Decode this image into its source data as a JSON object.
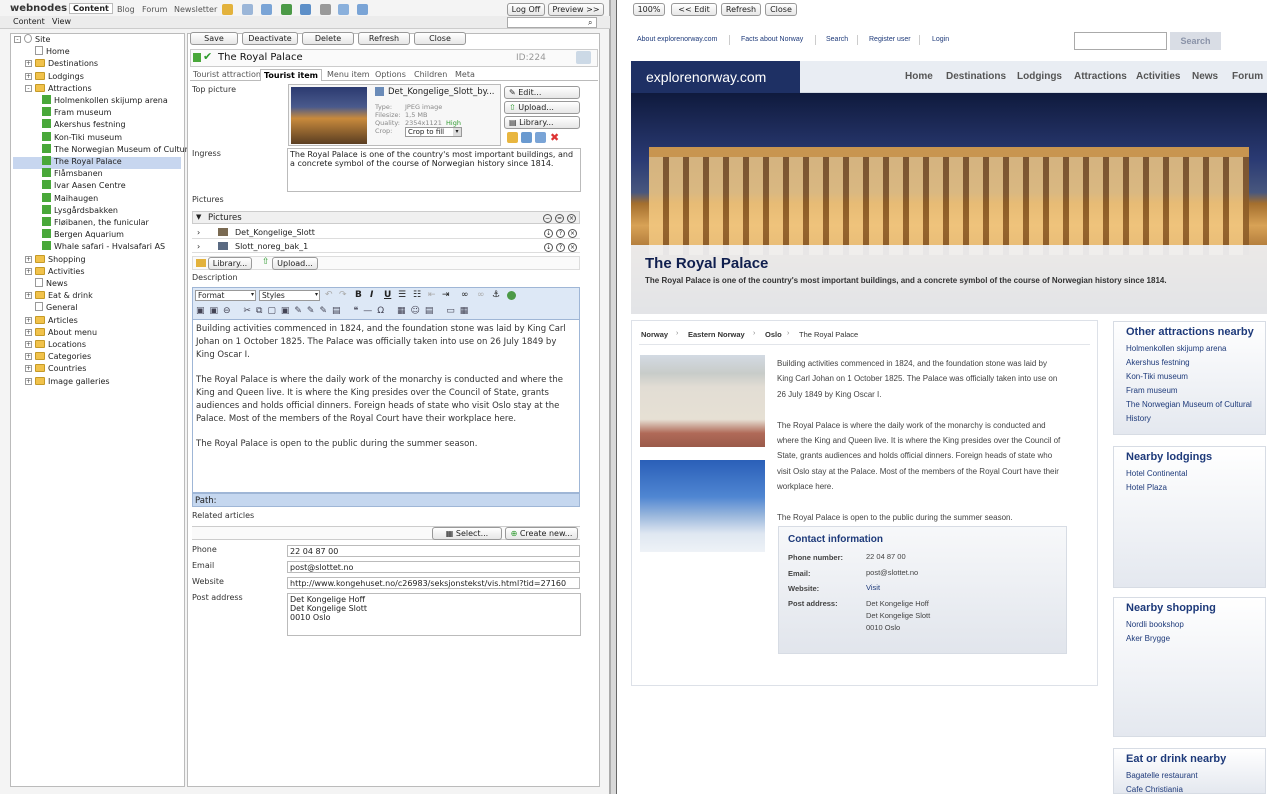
{
  "app": {
    "logo": "webnodes",
    "top_tabs": [
      "Content",
      "Blog",
      "Forum",
      "Newsletter"
    ],
    "log_off": "Log Off",
    "preview": "Preview >>",
    "menu": [
      "Content",
      "View"
    ]
  },
  "tree": [
    {
      "label": "Site",
      "type": "root",
      "exp": "-",
      "indent": 0
    },
    {
      "label": "Home",
      "type": "page",
      "exp": "",
      "indent": 1
    },
    {
      "label": "Destinations",
      "type": "folder",
      "exp": "+",
      "indent": 1
    },
    {
      "label": "Lodgings",
      "type": "folder",
      "exp": "+",
      "indent": 1
    },
    {
      "label": "Attractions",
      "type": "folder",
      "exp": "-",
      "indent": 1
    },
    {
      "label": "Holmenkollen skijump arena",
      "type": "green",
      "exp": "",
      "indent": 2
    },
    {
      "label": "Fram museum",
      "type": "green",
      "exp": "",
      "indent": 2
    },
    {
      "label": "Akershus festning",
      "type": "green",
      "exp": "",
      "indent": 2
    },
    {
      "label": "Kon-Tiki museum",
      "type": "green",
      "exp": "",
      "indent": 2
    },
    {
      "label": "The Norwegian Museum of Cultural",
      "type": "green",
      "exp": "",
      "indent": 2
    },
    {
      "label": "The Royal Palace",
      "type": "green",
      "exp": "",
      "indent": 2,
      "selected": true
    },
    {
      "label": "Flåmsbanen",
      "type": "green",
      "exp": "",
      "indent": 2
    },
    {
      "label": "Ivar Aasen Centre",
      "type": "green",
      "exp": "",
      "indent": 2
    },
    {
      "label": "Maihaugen",
      "type": "green",
      "exp": "",
      "indent": 2
    },
    {
      "label": "Lysgårdsbakken",
      "type": "green",
      "exp": "",
      "indent": 2
    },
    {
      "label": "Fløibanen, the funicular",
      "type": "green",
      "exp": "",
      "indent": 2
    },
    {
      "label": "Bergen Aquarium",
      "type": "green",
      "exp": "",
      "indent": 2
    },
    {
      "label": "Whale safari - Hvalsafari AS",
      "type": "green",
      "exp": "",
      "indent": 2
    },
    {
      "label": "Shopping",
      "type": "folder",
      "exp": "+",
      "indent": 1
    },
    {
      "label": "Activities",
      "type": "folder",
      "exp": "+",
      "indent": 1
    },
    {
      "label": "News",
      "type": "page",
      "exp": "",
      "indent": 1
    },
    {
      "label": "Eat & drink",
      "type": "folder",
      "exp": "+",
      "indent": 1
    },
    {
      "label": "General",
      "type": "page",
      "exp": "",
      "indent": 1
    },
    {
      "label": "Articles",
      "type": "folder",
      "exp": "+",
      "indent": 1
    },
    {
      "label": "About menu",
      "type": "folder",
      "exp": "+",
      "indent": 1
    },
    {
      "label": "Locations",
      "type": "folder",
      "exp": "+",
      "indent": 1
    },
    {
      "label": "Categories",
      "type": "folder",
      "exp": "+",
      "indent": 1
    },
    {
      "label": "Countries",
      "type": "folder",
      "exp": "+",
      "indent": 1
    },
    {
      "label": "Image galleries",
      "type": "folder",
      "exp": "+",
      "indent": 1
    }
  ],
  "editor": {
    "buttons": [
      "Save",
      "Deactivate",
      "Delete",
      "Refresh",
      "Close"
    ],
    "title": "The Royal Palace",
    "id": "ID:224",
    "tabs": [
      "Tourist attraction",
      "Tourist item",
      "Menu item",
      "Options",
      "Children",
      "Meta"
    ],
    "top_picture_label": "Top picture",
    "pic_name": "Det_Kongelige_Slott_by...",
    "pic_type_label": "Type:",
    "pic_type": "JPEG image",
    "pic_size_label": "Filesize:",
    "pic_size": "1,5 MB",
    "pic_quality_label": "Quality:",
    "pic_quality": "2354x1121",
    "pic_quality_note": "High",
    "pic_crop_label": "Crop:",
    "pic_crop": "Crop to fill",
    "edit": "Edit...",
    "upload": "Upload...",
    "library": "Library...",
    "ingress_label": "Ingress",
    "ingress": "The Royal Palace is one of the country's most important buildings, and a concrete symbol of the course of Norwegian history since 1814.",
    "pictures_label": "Pictures",
    "pictures_header": "Pictures",
    "pictures": [
      "Det_Kongelige_Slott",
      "Slott_noreg_bak_1"
    ],
    "pic_library": "Library...",
    "pic_upload": "Upload...",
    "description_label": "Description",
    "format": "Format",
    "styles": "Styles",
    "description": [
      "Building activities commenced in 1824, and the foundation stone was laid by King Carl Johan on 1 October 1825. The Palace was officially taken into use on 26 July 1849 by King Oscar I.",
      "The Royal Palace is where the daily work of the monarchy is conducted and where the King and Queen live. It is where the King presides over the Council of State, grants audiences and holds official dinners. Foreign heads of state who visit Oslo stay at the Palace. Most of the members of the Royal Court have their workplace here.",
      "The Royal Palace is open to the public during the summer season."
    ],
    "path_label": "Path:",
    "related_label": "Related articles",
    "select": "Select...",
    "create_new": "Create new...",
    "phone_label": "Phone",
    "phone": "22 04 87 00",
    "email_label": "Email",
    "email": "post@slottet.no",
    "website_label": "Website",
    "website": "http://www.kongehuset.no/c26983/seksjonstekst/vis.html?tid=27160",
    "post_label": "Post address",
    "post": [
      "Det Kongelige Hoff",
      "Det Kongelige Slott",
      "0010 Oslo"
    ]
  },
  "preview": {
    "zoom": "100%",
    "edit": "<< Edit",
    "refresh": "Refresh",
    "close": "Close",
    "toplinks": [
      "About explorenorway.com",
      "Facts about Norway",
      "Search",
      "Register user",
      "Login"
    ],
    "search_btn": "Search",
    "logo": "explorenorway.com",
    "nav": [
      "Home",
      "Destinations",
      "Lodgings",
      "Attractions",
      "Activities",
      "News",
      "Forum"
    ],
    "hero_title": "The Royal Palace",
    "hero_sub": "The Royal Palace is one of the country's most important buildings, and a concrete symbol of the course of Norwegian history since 1814.",
    "breadcrumb": [
      "Norway",
      "Eastern Norway",
      "Oslo",
      "The Royal Palace"
    ],
    "body": [
      "Building activities commenced in 1824, and the foundation stone was laid by King Carl Johan on 1 October 1825. The Palace was officially taken into use on 26 July 1849 by King Oscar I.",
      "The Royal Palace is where the daily work of the monarchy is conducted and where the King and Queen live. It is where the King presides over the Council of State, grants audiences and holds official dinners. Foreign heads of state who visit Oslo stay at the Palace. Most of the members of the Royal Court have their workplace here.",
      "The Royal Palace is open to the public during the summer season."
    ],
    "contact_title": "Contact information",
    "contact": {
      "phone_label": "Phone number:",
      "phone": "22 04 87 00",
      "email_label": "Email:",
      "email": "post@slottet.no",
      "website_label": "Website:",
      "website": "Visit",
      "post_label": "Post address:",
      "post": [
        "Det Kongelige Hoff",
        "Det Kongelige Slott",
        "0010 Oslo"
      ]
    },
    "sidebars": [
      {
        "title": "Other attractions nearby",
        "links": [
          "Holmenkollen skijump arena",
          "Akershus festning",
          "Kon-Tiki museum",
          "Fram museum",
          "The Norwegian Museum of Cultural History"
        ]
      },
      {
        "title": "Nearby lodgings",
        "links": [
          "Hotel Continental",
          "Hotel Plaza"
        ]
      },
      {
        "title": "Nearby shopping",
        "links": [
          "Nordli bookshop",
          "Aker Brygge"
        ]
      },
      {
        "title": "Eat or drink nearby",
        "links": [
          "Bagatelle restaurant",
          "Cafe Christiania"
        ]
      }
    ]
  },
  "colors": {
    "accent": "#1e3a7a",
    "nav_bg": "#e9edf3",
    "green": "#49a83a",
    "tree_select": "#c7d6ef"
  }
}
